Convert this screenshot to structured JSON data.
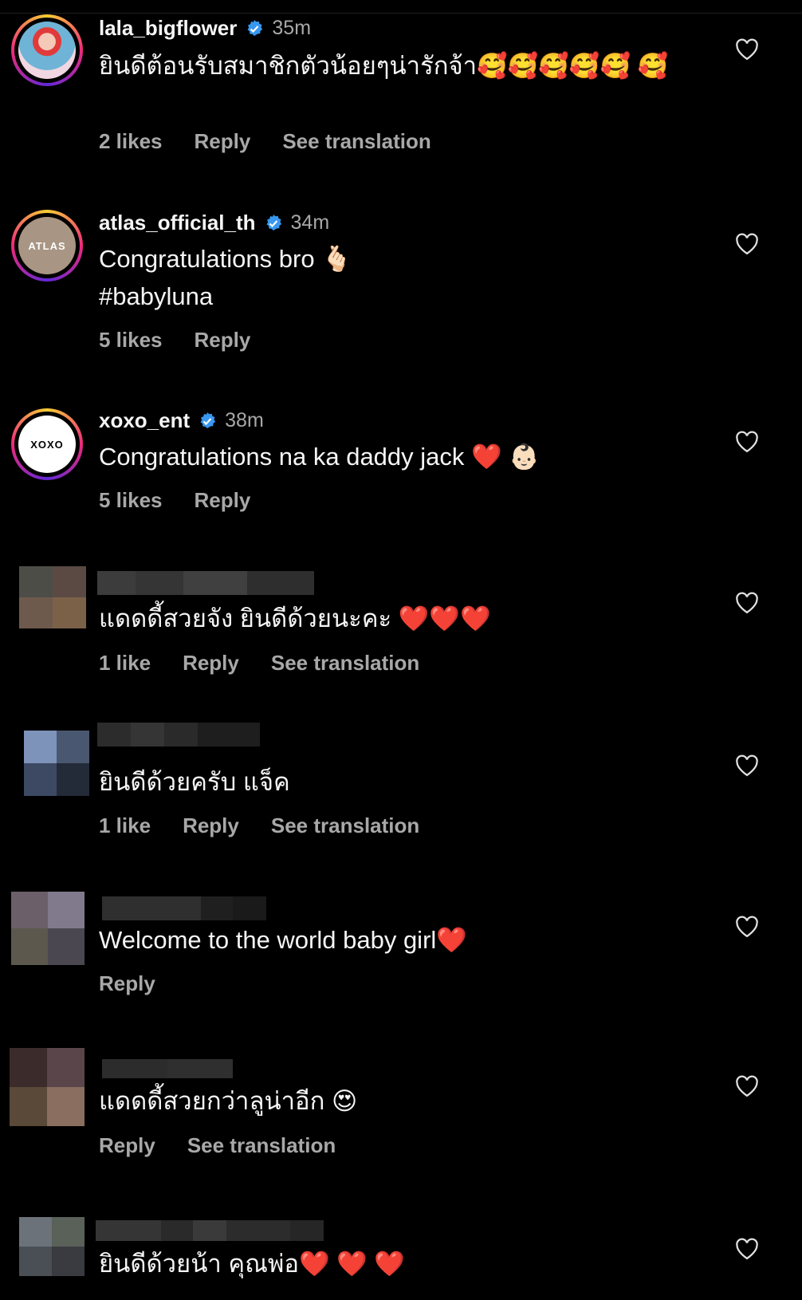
{
  "comments": [
    {
      "username": "lala_bigflower",
      "verified": true,
      "time": "35m",
      "text": "ยินดีต้อนรับสมาชิกตัวน้อยๆน่ารักจ้า🥰🥰🥰🥰🥰 🥰",
      "likes": "2 likes",
      "reply": "Reply",
      "translate": "See translation"
    },
    {
      "username": "atlas_official_th",
      "verified": true,
      "time": "34m",
      "avatar_text": "ATLAS",
      "text_line1": "Congratulations bro 🫰🏻",
      "text_line2": "#babyluna",
      "likes": "5 likes",
      "reply": "Reply"
    },
    {
      "username": "xoxo_ent",
      "verified": true,
      "time": "38m",
      "avatar_text": "XOXO",
      "text": "Congratulations na ka daddy jack ❤️ 👶🏻",
      "likes": "5 likes",
      "reply": "Reply"
    },
    {
      "text": "แดดดี้สวยจัง ยินดีด้วยนะคะ ❤️❤️❤️",
      "likes": "1 like",
      "reply": "Reply",
      "translate": "See translation"
    },
    {
      "text": "ยินดีด้วยครับ แจ็ค",
      "likes": "1 like",
      "reply": "Reply",
      "translate": "See translation"
    },
    {
      "text": "Welcome to the world baby girl❤️",
      "reply": "Reply"
    },
    {
      "text": "แดดดี้สวยกว่าลูน่าอีก 😍",
      "reply": "Reply",
      "translate": "See translation"
    },
    {
      "text": "ยินดีด้วยน้า  คุณพ่อ❤️ ❤️ ❤️"
    }
  ],
  "colors": {
    "background": "#000000",
    "text": "#f5f5f5",
    "muted": "#a8a8a8",
    "verified": "#3897f0"
  }
}
